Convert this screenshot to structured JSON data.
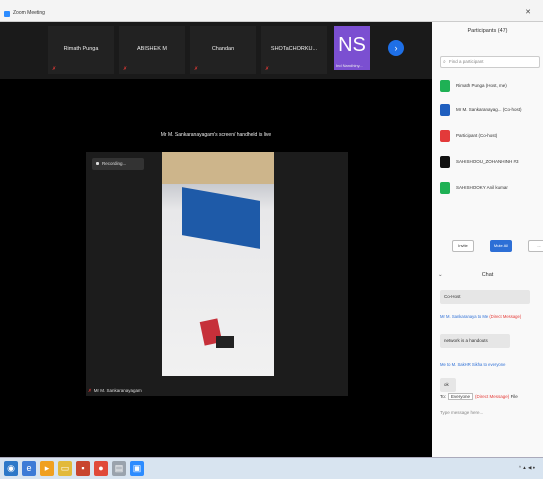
{
  "window": {
    "title": "Zoom Meeting"
  },
  "strip": {
    "tiles": [
      {
        "name": "Rimath Punga"
      },
      {
        "name": "ABISHEK M"
      },
      {
        "name": "Chandan"
      },
      {
        "name": "SHOTaCHORKU..."
      }
    ],
    "ns_tile": {
      "initials": "NS",
      "name": "Ind Nandhiny..."
    },
    "next_icon": "chevron-right-icon"
  },
  "share": {
    "banner": "Mr M. Sankaranayagam's screen/ handheld is live",
    "recording": "Recording...",
    "caption": "Mr M. Sankaranayagam"
  },
  "participants": {
    "header": "Participants (47)",
    "search_placeholder": "Find a participant",
    "list": [
      {
        "name": "Rimath Punga (Host, me)",
        "color": "#1fb155"
      },
      {
        "name": "Mr M. Sankaranayag... (Co-host)",
        "color": "#1f5fbf"
      },
      {
        "name": "Participant (Co-host)",
        "color": "#e33a3a"
      },
      {
        "name": "SAHISHOOU_ZOHANHINH #3",
        "color": "#111111"
      },
      {
        "name": "SAHISHOOKY Anil kumar",
        "color": "#1fb155"
      }
    ],
    "buttons": [
      "Invite",
      "Mute All",
      "..."
    ]
  },
  "chat": {
    "header": "Chat",
    "messages": [
      {
        "from": "Co-Host"
      },
      {
        "from": "Mr M. Sankaranaya to Me",
        "tag": "(Direct Message)"
      },
      {
        "bubble": "network is a handouts"
      },
      {
        "from": "Me to M. SakHR Sikha to everyone"
      },
      {
        "bubble": "ok"
      }
    ],
    "to_label": "To:",
    "to_value": "Everyone",
    "dm_label": "(Direct Message)",
    "file_label": "File",
    "input_placeholder": "Type message here..."
  },
  "taskbar": {
    "icons": [
      "windows-start-icon",
      "explorer-icon",
      "media-icon",
      "folder-icon",
      "office-icon",
      "chrome-icon",
      "notepad-icon",
      "zoom-icon"
    ],
    "tray": "^ ▲ ◀ ♦"
  }
}
